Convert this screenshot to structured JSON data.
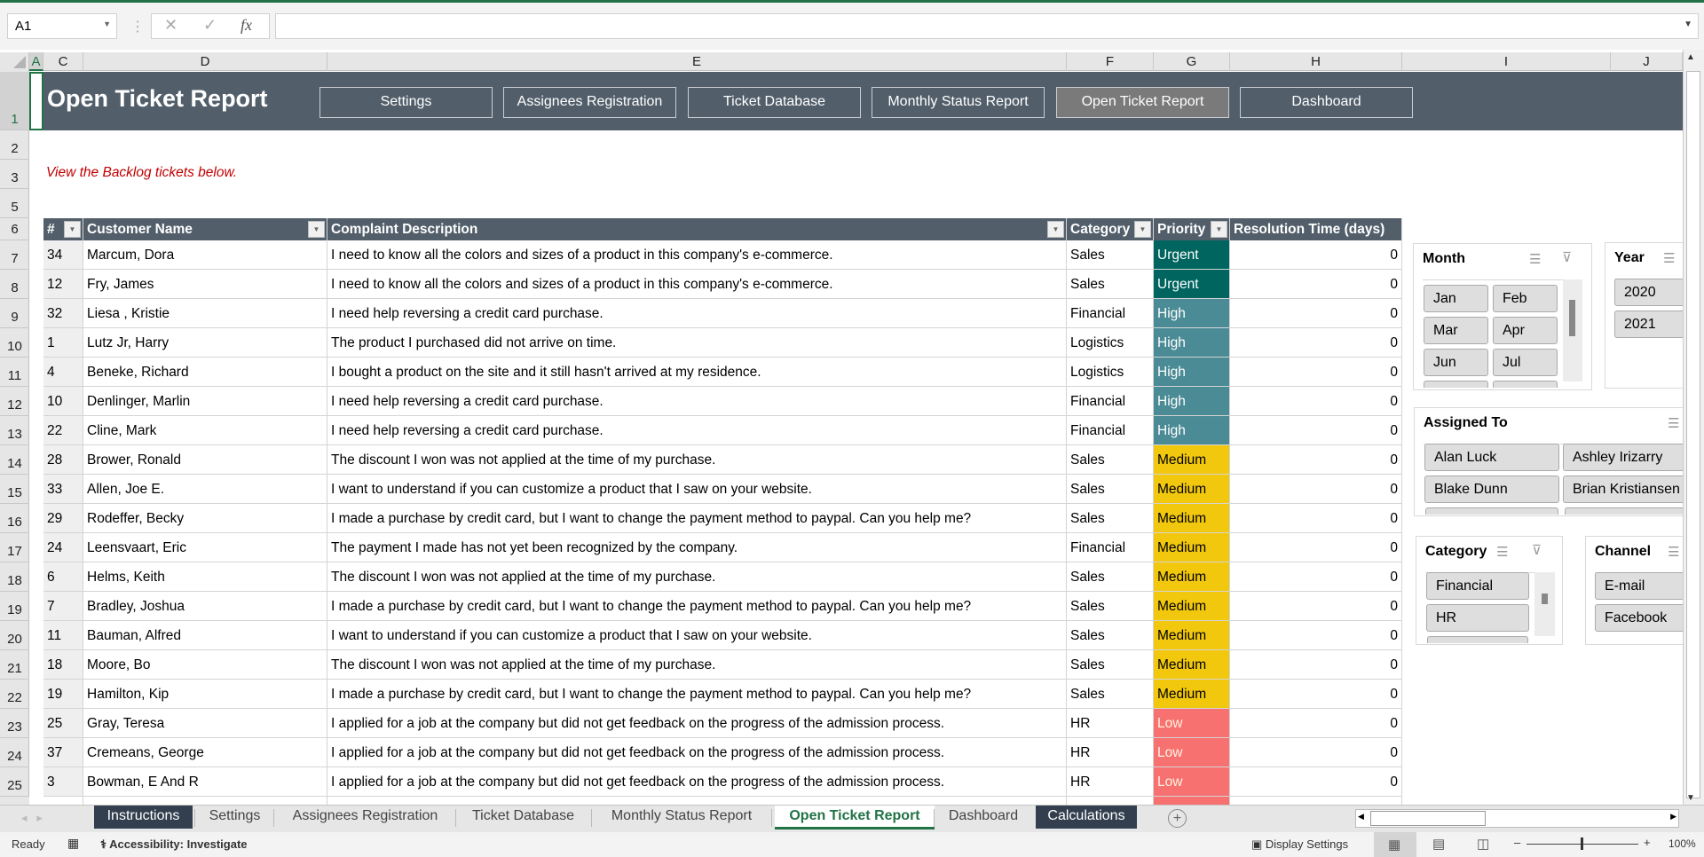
{
  "formula_bar": {
    "name_box": "A1",
    "cancel_icon": "✕",
    "enter_icon": "✓",
    "fx_label": "fx",
    "formula": ""
  },
  "columns": [
    "A",
    "C",
    "D",
    "E",
    "F",
    "G",
    "H",
    "I",
    "J"
  ],
  "rows": [
    "1",
    "2",
    "3",
    "5",
    "6",
    "7",
    "8",
    "9",
    "10",
    "11",
    "12",
    "13",
    "14",
    "15",
    "16",
    "17",
    "18",
    "19",
    "20",
    "21",
    "22",
    "23",
    "24",
    "25"
  ],
  "banner": {
    "title": "Open Ticket Report",
    "nav": [
      "Settings",
      "Assignees Registration",
      "Ticket Database",
      "Monthly Status Report",
      "Open Ticket Report",
      "Dashboard"
    ],
    "active": "Open Ticket Report",
    "color": "#525f6b"
  },
  "subtitle": "View the Backlog tickets below.",
  "table": {
    "headers": [
      "#",
      "Customer Name",
      "Complaint Description",
      "Category",
      "Priority",
      "Resolution Time (days)"
    ],
    "rows": [
      [
        "34",
        "Marcum, Dora",
        "I need to know all the colors and sizes of a product in this company's e-commerce.",
        "Sales",
        "Urgent",
        "0"
      ],
      [
        "12",
        "Fry, James",
        "I need to know all the colors and sizes of a product in this company's e-commerce.",
        "Sales",
        "Urgent",
        "0"
      ],
      [
        "32",
        "Liesa , Kristie",
        "I need help reversing a credit card purchase.",
        "Financial",
        "High",
        "0"
      ],
      [
        "1",
        "Lutz Jr, Harry",
        "The product I purchased did not arrive on time.",
        "Logistics",
        "High",
        "0"
      ],
      [
        "4",
        "Beneke, Richard",
        "I bought a product on the site and it still hasn't arrived at my residence.",
        "Logistics",
        "High",
        "0"
      ],
      [
        "10",
        "Denlinger, Marlin",
        "I need help reversing a credit card purchase.",
        "Financial",
        "High",
        "0"
      ],
      [
        "22",
        "Cline, Mark",
        "I need help reversing a credit card purchase.",
        "Financial",
        "High",
        "0"
      ],
      [
        "28",
        "Brower, Ronald",
        "The discount I won was not applied at the time of my purchase.",
        "Sales",
        "Medium",
        "0"
      ],
      [
        "33",
        "Allen, Joe E.",
        "I want to understand if you can customize a product that I saw on your website.",
        "Sales",
        "Medium",
        "0"
      ],
      [
        "29",
        "Rodeffer, Becky",
        "I made a purchase by credit card, but I want to change the payment method to paypal. Can you help me?",
        "Sales",
        "Medium",
        "0"
      ],
      [
        "24",
        "Leensvaart, Eric",
        "The payment I made has not yet been recognized by the company.",
        "Financial",
        "Medium",
        "0"
      ],
      [
        "6",
        "Helms, Keith",
        "The discount I won was not applied at the time of my purchase.",
        "Sales",
        "Medium",
        "0"
      ],
      [
        "7",
        "Bradley, Joshua",
        "I made a purchase by credit card, but I want to change the payment method to paypal. Can you help me?",
        "Sales",
        "Medium",
        "0"
      ],
      [
        "11",
        "Bauman, Alfred",
        "I want to understand if you can customize a product that I saw on your website.",
        "Sales",
        "Medium",
        "0"
      ],
      [
        "18",
        "Moore, Bo",
        "The discount I won was not applied at the time of my purchase.",
        "Sales",
        "Medium",
        "0"
      ],
      [
        "19",
        "Hamilton, Kip",
        "I made a purchase by credit card, but I want to change the payment method to paypal. Can you help me?",
        "Sales",
        "Medium",
        "0"
      ],
      [
        "25",
        "Gray, Teresa",
        "I applied for a job at the company but did not get feedback on the progress of the admission process.",
        "HR",
        "Low",
        "0"
      ],
      [
        "37",
        "Cremeans, George",
        "I applied for a job at the company but did not get feedback on the progress of the admission process.",
        "HR",
        "Low",
        "0"
      ],
      [
        "3",
        "Bowman, E And R",
        "I applied for a job at the company but did not get feedback on the progress of the admission process.",
        "HR",
        "Low",
        "0"
      ]
    ],
    "priority_colors": {
      "Urgent": "#00655f",
      "High": "#4a8b96",
      "Medium": "#f2c80f",
      "Low": "#f87171"
    },
    "priority_text_colors": {
      "Urgent": "#ffffff",
      "High": "#ffffff",
      "Medium": "#000000",
      "Low": "#fff3e0"
    }
  },
  "slicers": {
    "month": {
      "title": "Month",
      "items": [
        "Jan",
        "Feb",
        "Mar",
        "Apr",
        "Jun",
        "Jul"
      ]
    },
    "year": {
      "title": "Year",
      "items": [
        "2020",
        "2021"
      ]
    },
    "assigned_to": {
      "title": "Assigned To",
      "items": [
        "Alan Luck",
        "Ashley Irizarry",
        "Blake Dunn",
        "Brian Kristiansen"
      ]
    },
    "category": {
      "title": "Category",
      "items": [
        "Financial",
        "HR"
      ]
    },
    "channel": {
      "title": "Channel",
      "items": [
        "E-mail",
        "Facebook"
      ]
    }
  },
  "sheet_tabs": [
    "Instructions",
    "Settings",
    "Assignees Registration",
    "Ticket Database",
    "Monthly Status Report",
    "Open Ticket Report",
    "Dashboard",
    "Calculations"
  ],
  "active_tab": "Open Ticket Report",
  "status_bar": {
    "ready": "Ready",
    "accessibility": "Accessibility: Investigate",
    "display_settings": "Display Settings",
    "zoom": "100%"
  }
}
